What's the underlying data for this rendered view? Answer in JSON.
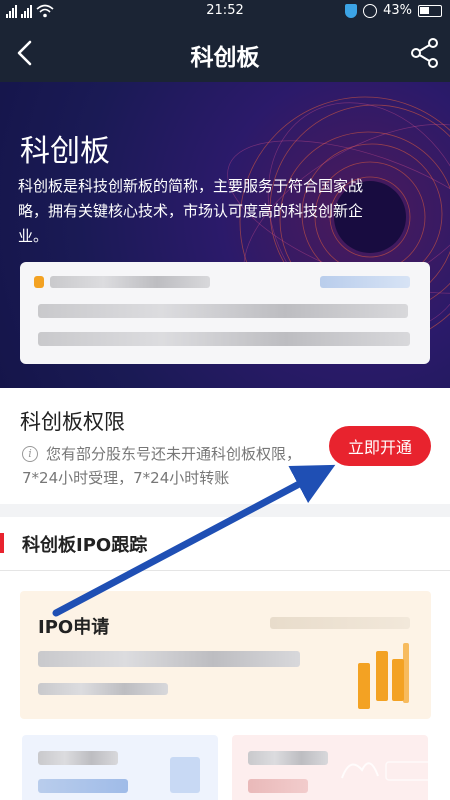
{
  "status_bar": {
    "time": "21:52",
    "battery": "43%"
  },
  "nav": {
    "title": "科创板"
  },
  "hero": {
    "title": "科创板",
    "description": "科创板是科技创新板的简称，主要服务于符合国家战略，拥有关键核心技术，市场认可度高的科技创新企业。"
  },
  "permission": {
    "title": "科创板权限",
    "description": "您有部分股东号还未开通科创板权限，7*24小时受理，7*24小时转账",
    "button_label": "立即开通"
  },
  "ipo": {
    "section_title": "科创板IPO跟踪",
    "card_label": "IPO申请"
  },
  "colors": {
    "bar_bg": "#1b2434",
    "accent_red": "#e8232e",
    "ipo_card_bg": "#fdf3e6",
    "candle_orange": "#f3a223",
    "arrow_blue": "#1f4fb4"
  },
  "icons": {
    "back": "chevron-left-icon",
    "share": "share-icon",
    "info": "info-icon",
    "candles": "candlestick-chart-icon"
  }
}
